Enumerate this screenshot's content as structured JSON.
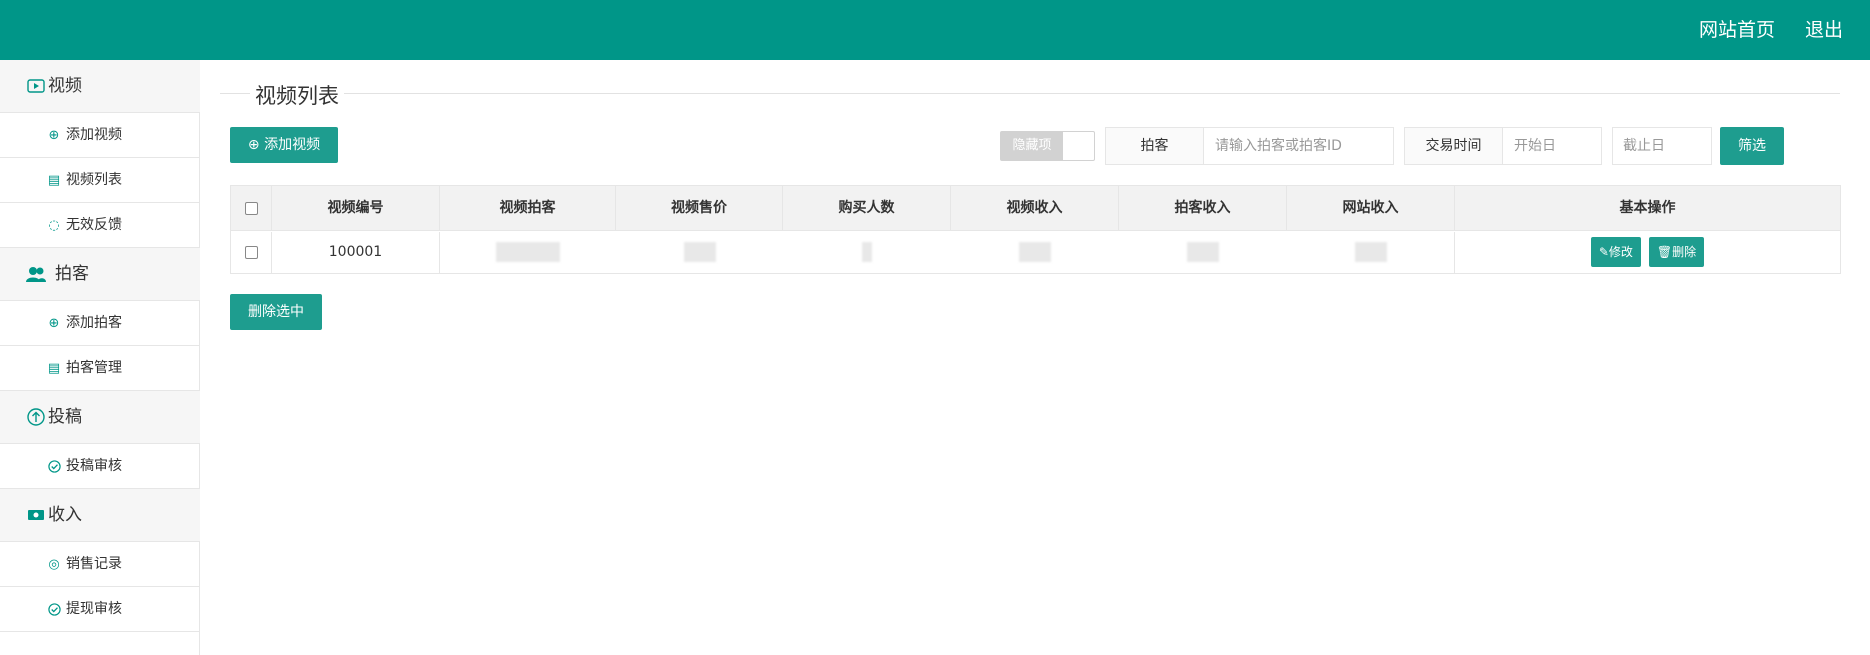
{
  "header": {
    "home_label": "网站首页",
    "logout_label": "退出",
    "bg_color": "#009688"
  },
  "sidebar": {
    "groups": [
      {
        "label": "视频",
        "icon": "video-icon",
        "items": [
          {
            "label": "添加视频",
            "icon": "plus-circle-icon"
          },
          {
            "label": "视频列表",
            "icon": "document-icon"
          },
          {
            "label": "无效反馈",
            "icon": "chat-icon"
          }
        ]
      },
      {
        "label": "拍客",
        "icon": "users-icon",
        "items": [
          {
            "label": "添加拍客",
            "icon": "plus-circle-icon"
          },
          {
            "label": "拍客管理",
            "icon": "document-icon"
          }
        ]
      },
      {
        "label": "投稿",
        "icon": "upload-icon",
        "items": [
          {
            "label": "投稿审核",
            "icon": "check-circle-icon"
          }
        ]
      },
      {
        "label": "收入",
        "icon": "money-icon",
        "items": [
          {
            "label": "销售记录",
            "icon": "coin-icon"
          },
          {
            "label": "提现审核",
            "icon": "check-circle-icon"
          }
        ]
      }
    ]
  },
  "main": {
    "title": "视频列表",
    "add_button": "添加视频",
    "hidden_toggle": "隐藏项",
    "filter_client_label": "拍客",
    "filter_client_placeholder": "请输入拍客或拍客ID",
    "filter_time_label": "交易时间",
    "start_placeholder": "开始日",
    "end_placeholder": "截止日",
    "filter_button": "筛选",
    "delete_selected": "删除选中"
  },
  "table": {
    "headers": [
      "视频编号",
      "视频拍客",
      "视频售价",
      "购买人数",
      "视频收入",
      "拍客收入",
      "网站收入",
      "基本操作"
    ],
    "rows": [
      {
        "id": "100001",
        "edit": "修改",
        "delete": "删除"
      }
    ]
  },
  "accent_color": "#1e9d8f"
}
